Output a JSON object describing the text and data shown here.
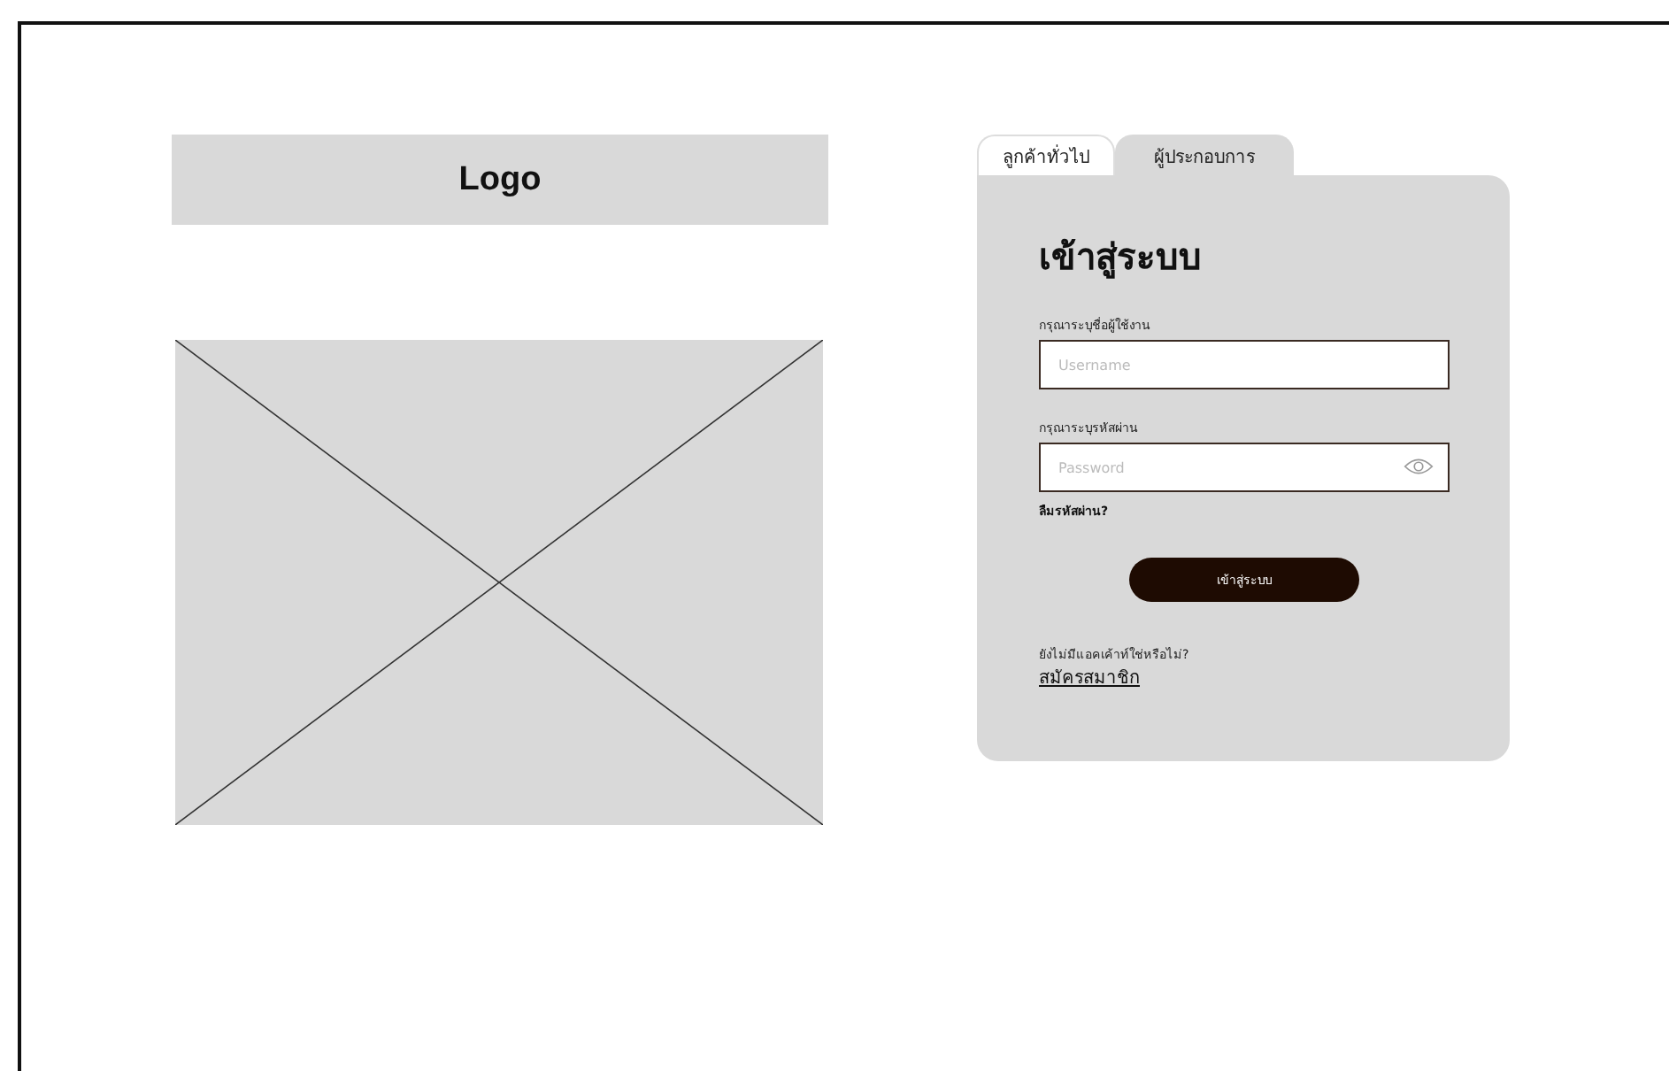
{
  "logo": {
    "text": "Logo"
  },
  "image": {
    "kind": "placeholder"
  },
  "tabs": [
    {
      "label": "ลูกค้าทั่วไป",
      "selected": false
    },
    {
      "label": "ผู้ประกอบการ",
      "selected": true
    }
  ],
  "login": {
    "title": "เข้าสู่ระบบ",
    "fields": [
      {
        "label": "กรุณาระบุชื่อผู้ใช้งาน",
        "placeholder": "Username",
        "kind": "text"
      },
      {
        "label": "กรุณาระบุรหัสผ่าน",
        "placeholder": "Password",
        "kind": "password"
      }
    ],
    "forgot_link": "ลืมรหัสผ่าน?",
    "submit_button": "เข้าสู่ระบบ",
    "signup_prompt": "ยังไม่มีแอคเค้าท์ใช่หรือไม่?",
    "signup_link": "สมัครสมาชิก"
  }
}
